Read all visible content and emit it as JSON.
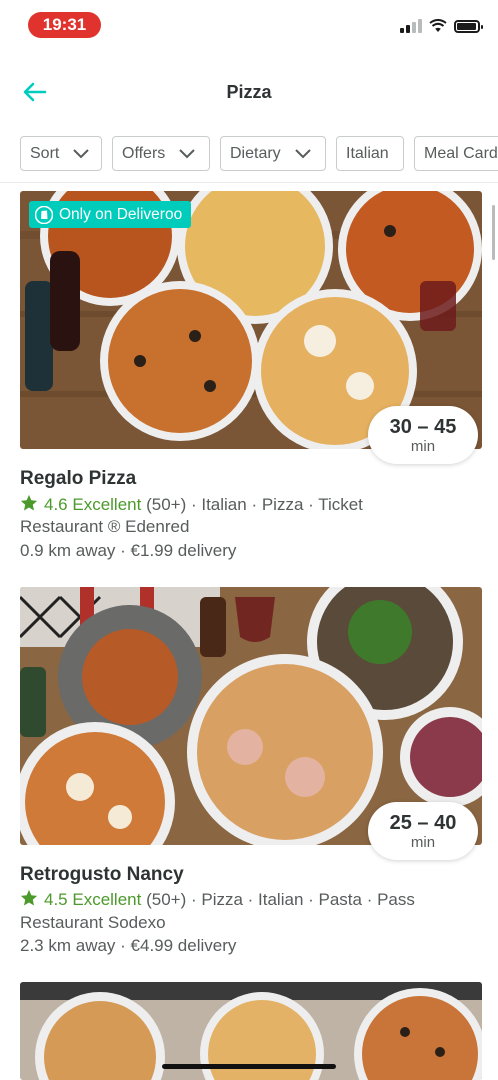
{
  "status": {
    "time": "19:31"
  },
  "header": {
    "title": "Pizza"
  },
  "filters": [
    "Sort",
    "Offers",
    "Dietary",
    "Italian",
    "Meal Card"
  ],
  "restaurants": [
    {
      "promo": "Only on Deliveroo",
      "time_range": "30 – 45",
      "time_unit": "min",
      "name": "Regalo Pizza",
      "rating": "4.6 Excellent",
      "reviews": "(50+)",
      "tags_line1": " · Italian · Pizza · Ticket",
      "tags_line2": "Restaurant ® Edenred",
      "distance": "0.9 km away · €1.99 delivery"
    },
    {
      "time_range": "25 – 40",
      "time_unit": "min",
      "name": "Retrogusto Nancy",
      "rating": "4.5 Excellent",
      "reviews": "(50+)",
      "tags_line1": " · Pizza · Italian · Pasta · Pass",
      "tags_line2": "Restaurant Sodexo",
      "distance": "2.3 km away · €4.99 delivery"
    }
  ],
  "colors": {
    "teal": "#00ccbc",
    "rating_green": "#4d9a2c",
    "status_red": "#e0332d"
  }
}
